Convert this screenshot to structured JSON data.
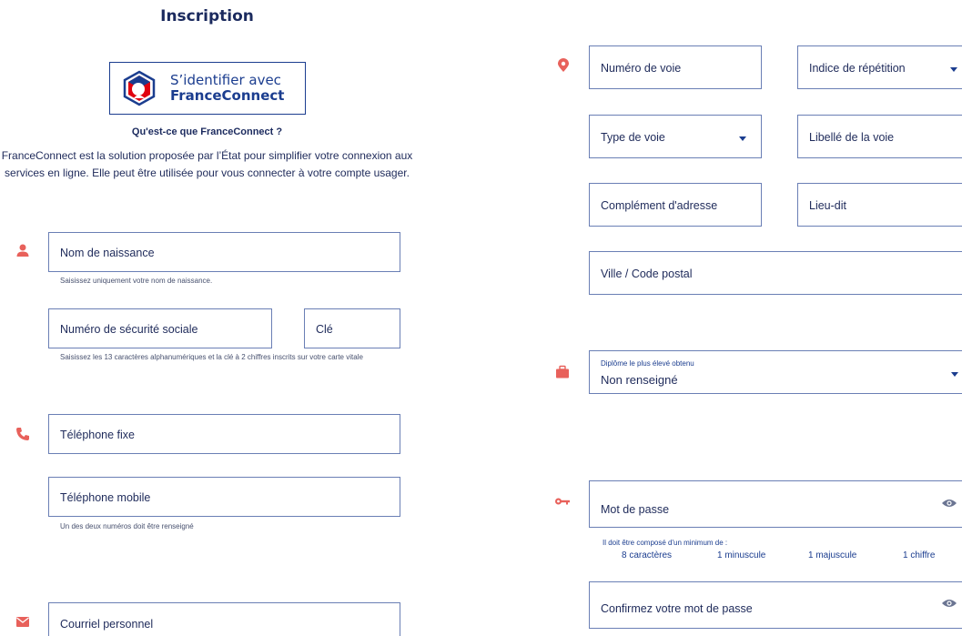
{
  "header": {
    "title": "Inscription"
  },
  "franceconnect": {
    "button_line1": "S’identifier avec",
    "button_line2": "FranceConnect",
    "question": "Qu'est-ce que FranceConnect ?",
    "description_line1": "FranceConnect est la solution proposée par l’État pour simplifier votre connexion aux",
    "description_line2": "services en ligne. Elle peut être utilisée pour vous connecter à votre compte usager."
  },
  "identity": {
    "birth_name_placeholder": "Nom de naissance",
    "birth_name_hint": "Saisissez uniquement votre nom de naissance.",
    "ssn_placeholder": "Numéro de sécurité sociale",
    "key_placeholder": "Clé",
    "ssn_hint": "Saisissez les 13 caractères alphanumériques et la clé à 2 chiffres inscrits sur votre carte vitale"
  },
  "phone": {
    "landline_placeholder": "Téléphone fixe",
    "mobile_placeholder": "Téléphone mobile",
    "hint": "Un des deux numéros doit être renseigné"
  },
  "email": {
    "placeholder": "Courriel personnel"
  },
  "address": {
    "street_number_placeholder": "Numéro de voie",
    "repetition_index_placeholder": "Indice de répétition",
    "street_type_placeholder": "Type de voie",
    "street_label_placeholder": "Libellé de la voie",
    "address_complement_placeholder": "Complément d'adresse",
    "locality_placeholder": "Lieu-dit",
    "city_postcode_placeholder": "Ville / Code postal"
  },
  "diploma": {
    "label": "Diplôme le plus élevé obtenu",
    "value": "Non renseigné"
  },
  "password": {
    "placeholder": "Mot de passe",
    "rules_title": "Il doit être composé d'un minimum de :",
    "rules": [
      "8 caractères",
      "1 minuscule",
      "1 majuscule",
      "1 chiffre"
    ],
    "confirm_placeholder": "Confirmez votre mot de passe"
  },
  "colors": {
    "accent": "#e8615b",
    "primary": "#1b3d8f",
    "border": "#6a7fb5"
  },
  "icons": {
    "identity": "person-icon",
    "phone": "phone-icon",
    "email": "envelope-icon",
    "address": "map-pin-icon",
    "diploma": "briefcase-icon",
    "password": "key-icon",
    "show_password": "eye-icon"
  }
}
